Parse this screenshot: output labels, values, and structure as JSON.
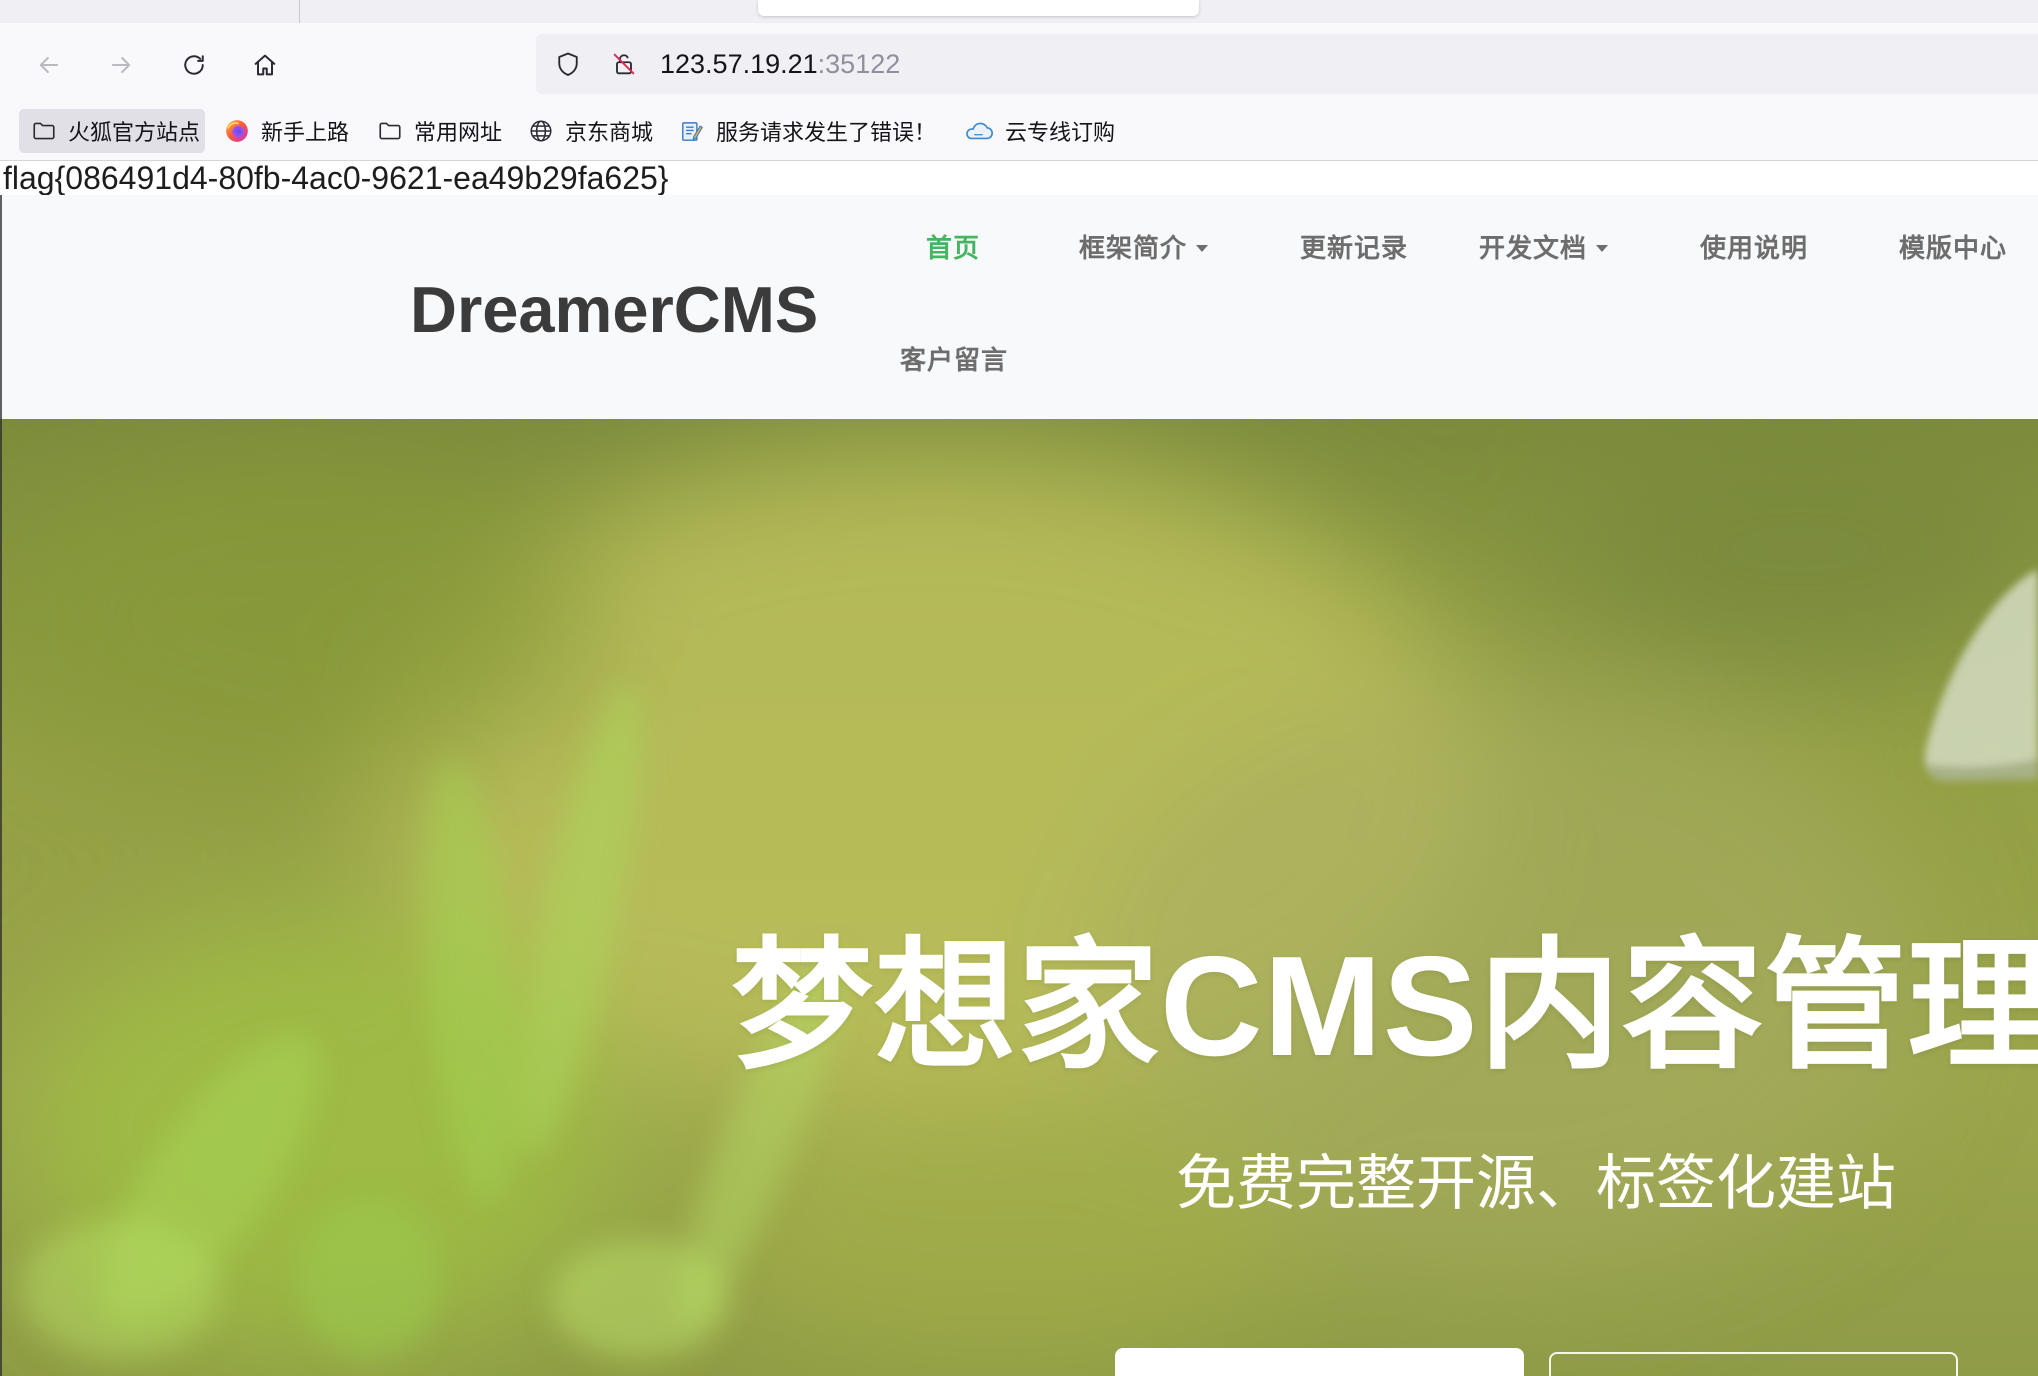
{
  "browser": {
    "url": {
      "host": "123.57.19.21",
      "port": ":35122"
    },
    "toolbar_icons": {
      "back": "back-arrow-icon",
      "forward": "forward-arrow-icon",
      "reload": "reload-icon",
      "home": "home-icon",
      "site_info": "shield-icon",
      "connection": "insecure-lock-icon"
    },
    "bookmarks": [
      {
        "label": "火狐官方站点",
        "icon": "folder-icon"
      },
      {
        "label": "新手上路",
        "icon": "firefox-icon"
      },
      {
        "label": "常用网址",
        "icon": "folder-icon"
      },
      {
        "label": "京东商城",
        "icon": "globe-icon"
      },
      {
        "label": "服务请求发生了错误！",
        "icon": "document-pen-icon"
      },
      {
        "label": "云专线订购",
        "icon": "cloud-icon"
      }
    ]
  },
  "page": {
    "flag_text": "flag{086491d4-80fb-4ac0-9621-ea49b29fa625}",
    "logo": "DreamerCMS",
    "nav": [
      {
        "label": "首页",
        "active": true,
        "dropdown": false
      },
      {
        "label": "框架简介",
        "active": false,
        "dropdown": true
      },
      {
        "label": "更新记录",
        "active": false,
        "dropdown": false
      },
      {
        "label": "开发文档",
        "active": false,
        "dropdown": true
      },
      {
        "label": "使用说明",
        "active": false,
        "dropdown": false
      },
      {
        "label": "模版中心",
        "active": false,
        "dropdown": false
      },
      {
        "label": "客户留言",
        "active": false,
        "dropdown": false
      }
    ],
    "hero": {
      "title": "梦想家CMS内容管理",
      "subtitle": "免费完整开源、标签化建站"
    }
  },
  "colors": {
    "accent": "#45b561",
    "nav_text": "#6d6d6d",
    "logo_text": "#3b3b3b",
    "url_port": "#8f8f9d",
    "hero_text": "#ffffff"
  }
}
